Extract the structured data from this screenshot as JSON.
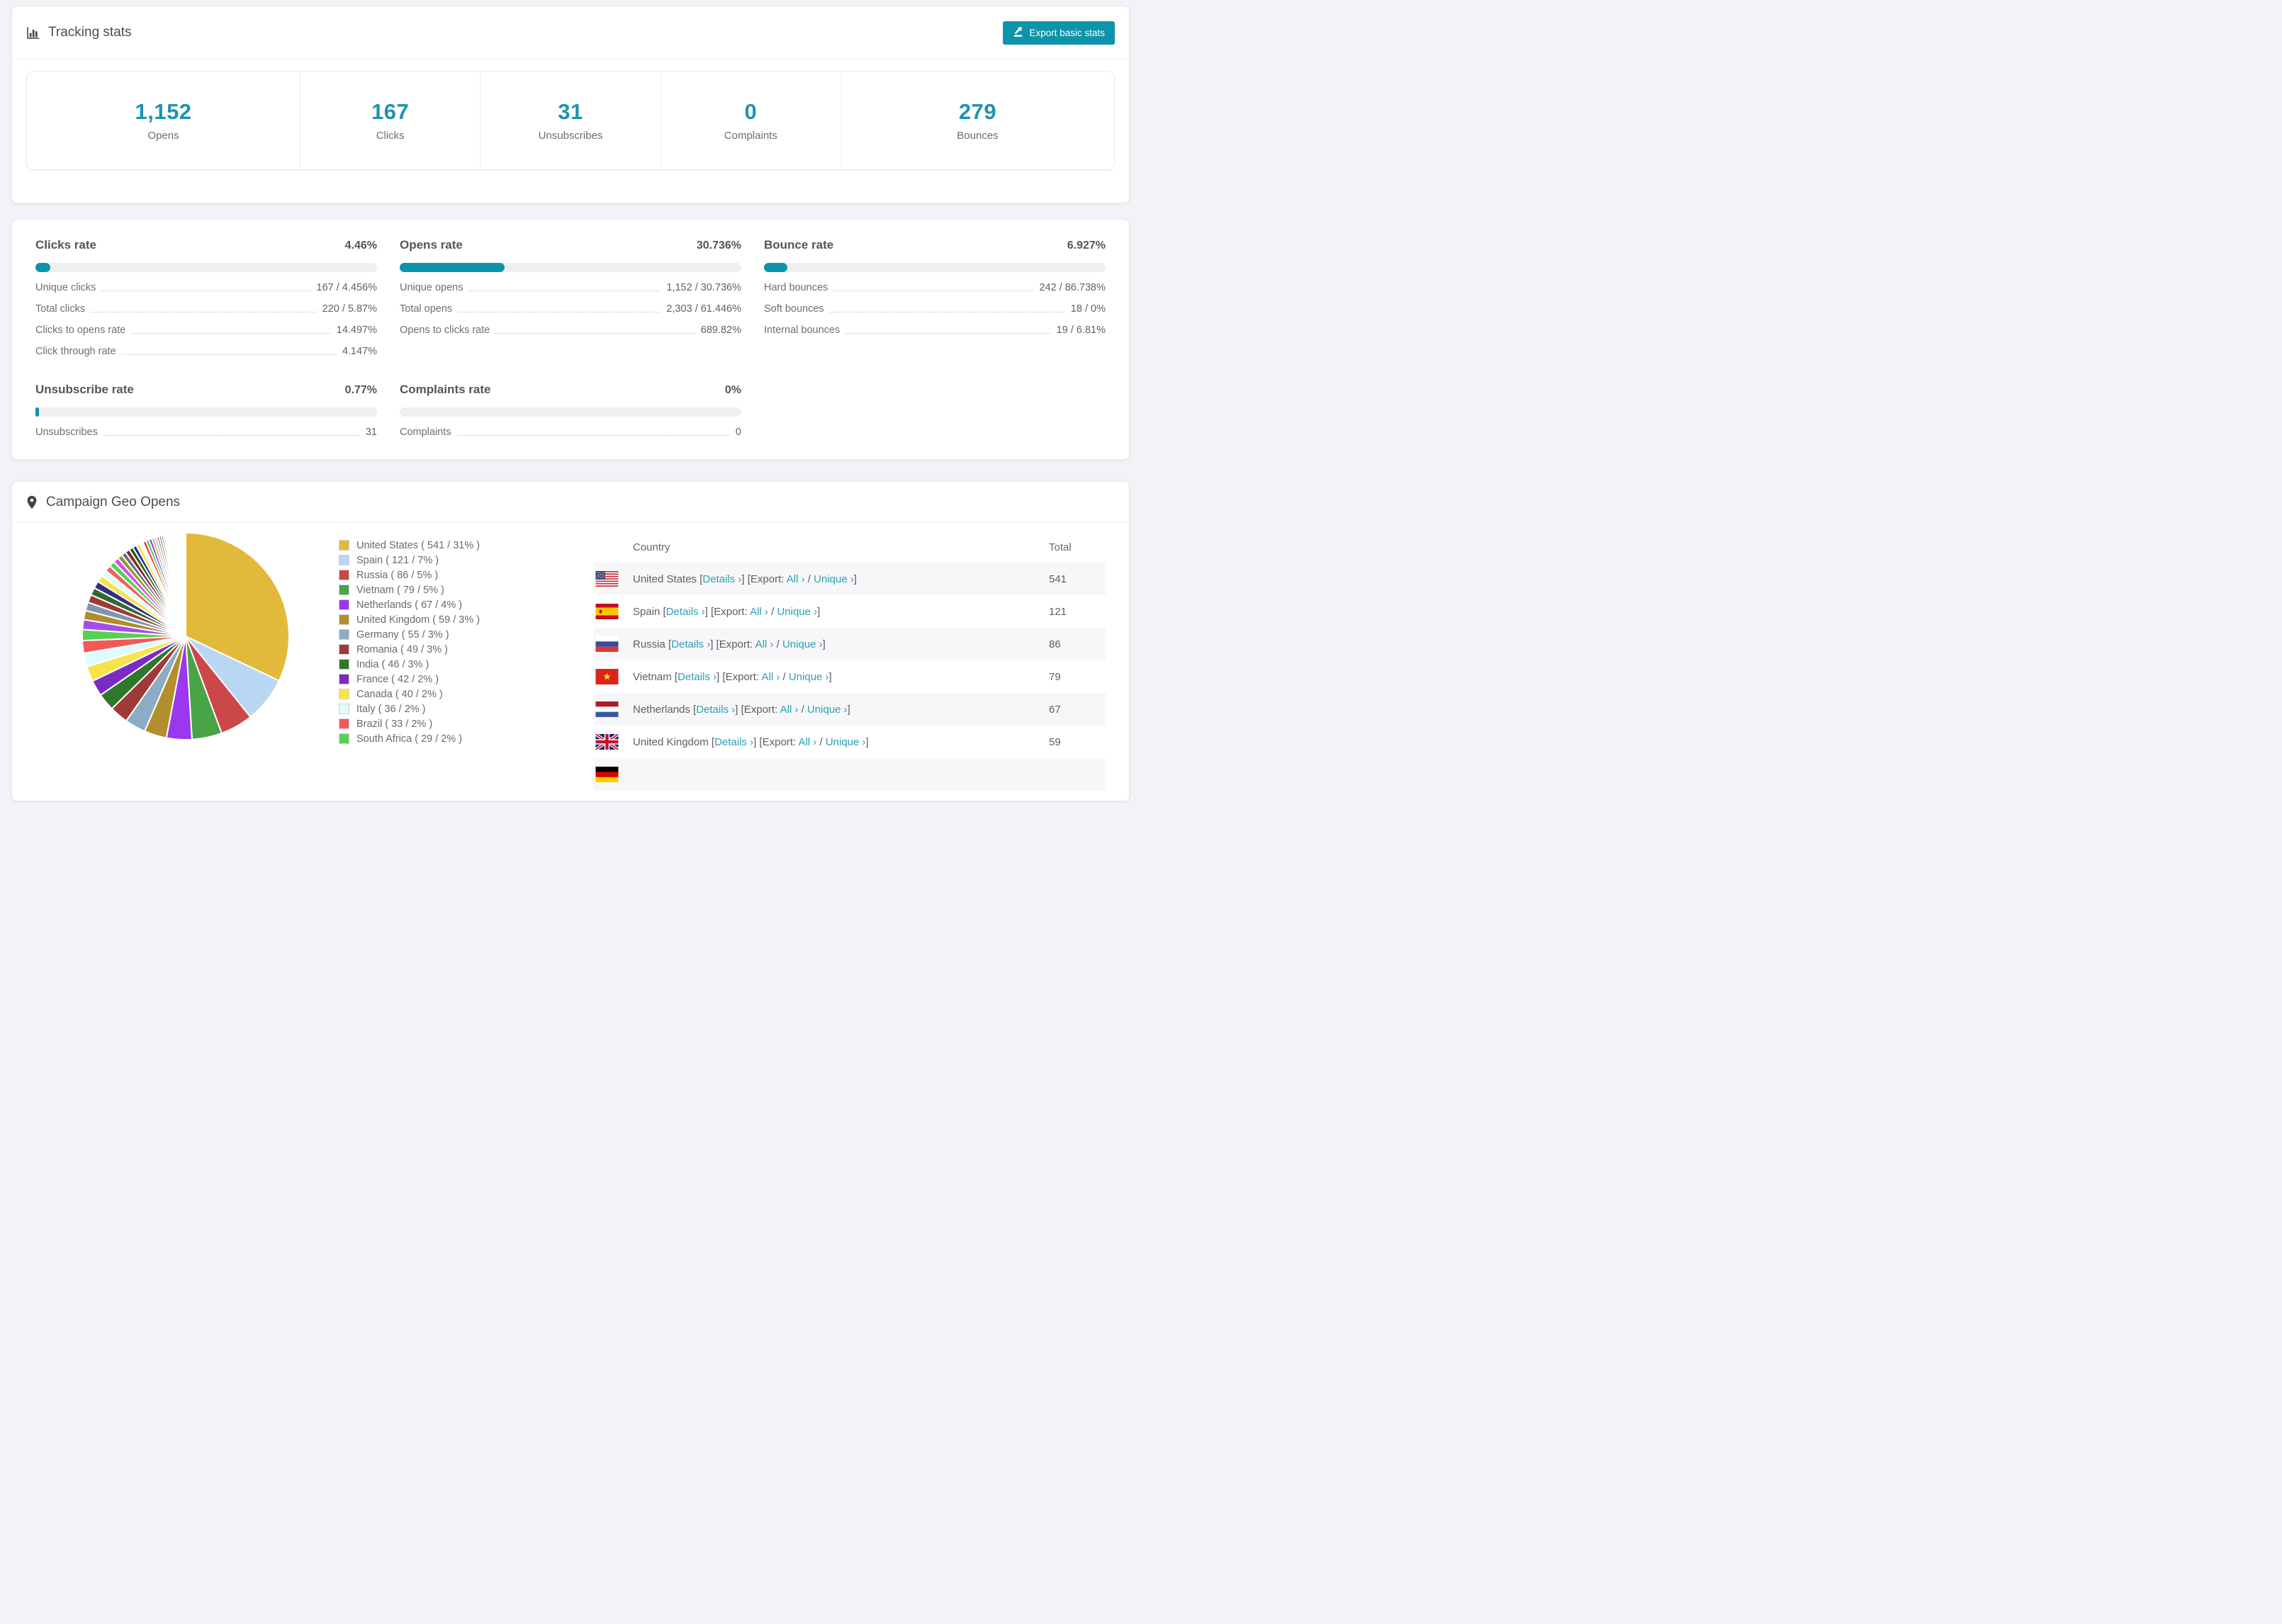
{
  "tracking": {
    "title": "Tracking stats",
    "export_label": "Export basic stats",
    "summary": [
      {
        "value": "1,152",
        "label": "Opens"
      },
      {
        "value": "167",
        "label": "Clicks"
      },
      {
        "value": "31",
        "label": "Unsubscribes"
      },
      {
        "value": "0",
        "label": "Complaints"
      },
      {
        "value": "279",
        "label": "Bounces"
      }
    ]
  },
  "rates": {
    "blocks": [
      {
        "title": "Clicks rate",
        "value": "4.46%",
        "percent": 4.46,
        "rows": [
          [
            "Unique clicks",
            "167 / 4.456%"
          ],
          [
            "Total clicks",
            "220 / 5.87%"
          ],
          [
            "Clicks to opens rate",
            "14.497%"
          ],
          [
            "Click through rate",
            "4.147%"
          ]
        ]
      },
      {
        "title": "Opens rate",
        "value": "30.736%",
        "percent": 30.736,
        "rows": [
          [
            "Unique opens",
            "1,152 / 30.736%"
          ],
          [
            "Total opens",
            "2,303 / 61.446%"
          ],
          [
            "Opens to clicks rate",
            "689.82%"
          ]
        ]
      },
      {
        "title": "Bounce rate",
        "value": "6.927%",
        "percent": 6.927,
        "rows": [
          [
            "Hard bounces",
            "242 / 86.738%"
          ],
          [
            "Soft bounces",
            "18 / 0%"
          ],
          [
            "Internal bounces",
            "19 / 6.81%"
          ]
        ]
      },
      {
        "title": "Unsubscribe rate",
        "value": "0.77%",
        "percent": 0.77,
        "rows": [
          [
            "Unsubscribes",
            "31"
          ]
        ]
      },
      {
        "title": "Complaints rate",
        "value": "0%",
        "percent": 0,
        "rows": [
          [
            "Complaints",
            "0"
          ]
        ]
      }
    ]
  },
  "geo": {
    "title": "Campaign Geo Opens",
    "table": {
      "headers": [
        "Country",
        "Total"
      ],
      "links": {
        "details": "Details ›",
        "all": "All ›",
        "unique": "Unique ›"
      },
      "fmt": {
        "open": "[",
        "close": "]",
        "export_open": "[Export:",
        "slash": "/"
      },
      "rows": [
        {
          "country": "United States",
          "flag": "us",
          "total": "541"
        },
        {
          "country": "Spain",
          "flag": "es",
          "total": "121"
        },
        {
          "country": "Russia",
          "flag": "ru",
          "total": "86"
        },
        {
          "country": "Vietnam",
          "flag": "vn",
          "total": "79"
        },
        {
          "country": "Netherlands",
          "flag": "nl",
          "total": "67"
        },
        {
          "country": "United Kingdom",
          "flag": "gb",
          "total": "59"
        },
        {
          "country": "",
          "flag": "de",
          "total": ""
        }
      ]
    }
  },
  "chart_data": {
    "type": "pie",
    "title": "Campaign Geo Opens",
    "legend_position": "right",
    "start_angle_deg": -90,
    "direction": "clockwise",
    "series": [
      {
        "name": "United States",
        "value": 541,
        "pct": 31,
        "color": "#e2b93b"
      },
      {
        "name": "Spain",
        "value": 121,
        "pct": 7,
        "color": "#b9d7f3"
      },
      {
        "name": "Russia",
        "value": 86,
        "pct": 5,
        "color": "#cc4748"
      },
      {
        "name": "Vietnam",
        "value": 79,
        "pct": 5,
        "color": "#47a447"
      },
      {
        "name": "Netherlands",
        "value": 67,
        "pct": 4,
        "color": "#9a37ef"
      },
      {
        "name": "United Kingdom",
        "value": 59,
        "pct": 3,
        "color": "#b18f2c"
      },
      {
        "name": "Germany",
        "value": 55,
        "pct": 3,
        "color": "#8cabc4"
      },
      {
        "name": "Romania",
        "value": 49,
        "pct": 3,
        "color": "#9e3a3a"
      },
      {
        "name": "India",
        "value": 46,
        "pct": 3,
        "color": "#2e782e"
      },
      {
        "name": "France",
        "value": 42,
        "pct": 2,
        "color": "#7b2bc4"
      },
      {
        "name": "Canada",
        "value": 40,
        "pct": 2,
        "color": "#f7e44c"
      },
      {
        "name": "Italy",
        "value": 36,
        "pct": 2,
        "color": "#dcfdfd"
      },
      {
        "name": "Brazil",
        "value": 33,
        "pct": 2,
        "color": "#f25858"
      },
      {
        "name": "South Africa",
        "value": 29,
        "pct": 2,
        "color": "#56d156"
      }
    ],
    "tail_values": [
      26,
      24,
      22,
      21,
      20,
      19,
      18,
      17,
      16,
      15,
      14,
      13,
      12,
      12,
      11,
      10,
      10,
      9,
      9,
      8,
      8,
      7,
      7,
      6,
      6,
      5,
      5,
      5,
      4,
      4,
      4,
      3,
      3,
      3,
      3,
      2,
      2,
      2,
      2,
      2,
      2,
      1,
      1,
      1,
      1,
      1,
      1,
      1,
      1,
      1,
      1,
      1,
      1,
      1
    ],
    "tail_palette": [
      "#a64ced",
      "#b08c2a",
      "#7d97ad",
      "#9c3a3a",
      "#2f6b2f",
      "#352f7d",
      "#f2e54c",
      "#e4fafa",
      "#f26060",
      "#52d452",
      "#d94ced",
      "#97972a",
      "#5f7482",
      "#7d2525",
      "#1f5c1f",
      "#25257d",
      "#f2e54c",
      "#e8fcfc",
      "#ed4040",
      "#40c440",
      "#8c35d9",
      "#c49c2a",
      "#9cbfe0",
      "#d45252",
      "#4c9c4c",
      "#6d2bbf",
      "#f5ef6a",
      "#ddfaff",
      "#f58a8a",
      "#7de89c",
      "#e06df2",
      "#a3a32e",
      "#7d8f9c",
      "#8f2f2f",
      "#2f7d2f",
      "#2f2f8f",
      "#f7f14c",
      "#eefcfc",
      "#f24c4c",
      "#c030d3",
      "#bfbf35",
      "#90a4ae"
    ]
  },
  "colors": {
    "accent_teal": "#0d94aa",
    "number_teal": "#1e93ad",
    "link_teal": "#2b9fb5",
    "track_gray": "#edeff3",
    "page_bg": "#f1f3f6",
    "zebra_row": "#f7f7f9"
  }
}
